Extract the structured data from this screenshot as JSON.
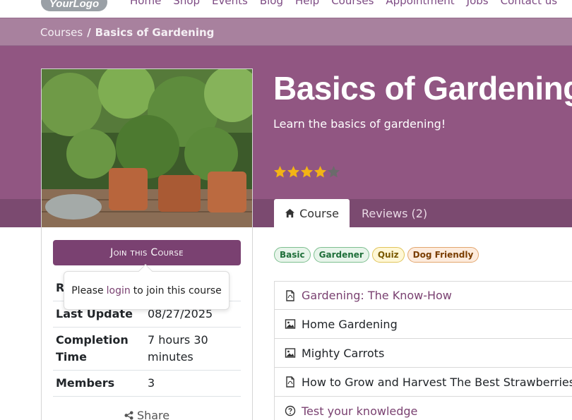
{
  "nav": {
    "logo_text": "YourLogo",
    "links": [
      "Home",
      "Shop",
      "Events",
      "Blog",
      "Help",
      "Courses",
      "Appointment",
      "Jobs",
      "Contact us"
    ]
  },
  "breadcrumb": {
    "parent": "Courses",
    "separator": "/",
    "current": "Basics of Gardening"
  },
  "course": {
    "title": "Basics of Gardening",
    "subtitle": "Learn the basics of gardening!",
    "rating": 4,
    "rating_max": 5,
    "join_label": "Join this Course"
  },
  "popover": {
    "prefix": "Please",
    "link": "login",
    "suffix": "to join this course"
  },
  "meta": [
    {
      "key": "Responsible",
      "value": ""
    },
    {
      "key": "Last Update",
      "value": "08/27/2025"
    },
    {
      "key": "Completion Time",
      "value": "7 hours 30 minutes"
    },
    {
      "key": "Members",
      "value": "3"
    }
  ],
  "share_label": "Share",
  "tabs": {
    "course": "Course",
    "reviews": "Reviews (2)"
  },
  "tags": [
    {
      "label": "Basic",
      "color": "#1f6f3a",
      "bg": "#e7f4ea",
      "border": "#7dbf8f"
    },
    {
      "label": "Gardener",
      "color": "#1f6f3a",
      "bg": "#e7f4ea",
      "border": "#7dbf8f"
    },
    {
      "label": "Quiz",
      "color": "#7a5a00",
      "bg": "#fff7d6",
      "border": "#e0c45a"
    },
    {
      "label": "Dog Friendly",
      "color": "#7a3d00",
      "bg": "#fdebdd",
      "border": "#e2a66e"
    }
  ],
  "contents": [
    {
      "title": "Gardening: The Know-How",
      "icon": "pdf-icon",
      "link": true
    },
    {
      "title": "Home Gardening",
      "icon": "image-icon",
      "link": false
    },
    {
      "title": "Mighty Carrots",
      "icon": "image-icon",
      "link": false
    },
    {
      "title": "How to Grow and Harvest The Best Strawberries | B",
      "icon": "pdf-icon",
      "link": false
    },
    {
      "title": "Test your knowledge",
      "icon": "question-icon",
      "link": true
    }
  ],
  "colors": {
    "brand": "#7a4171",
    "hero": "#915682",
    "star": "#f3b415",
    "star_empty": "#6b6b6b"
  }
}
